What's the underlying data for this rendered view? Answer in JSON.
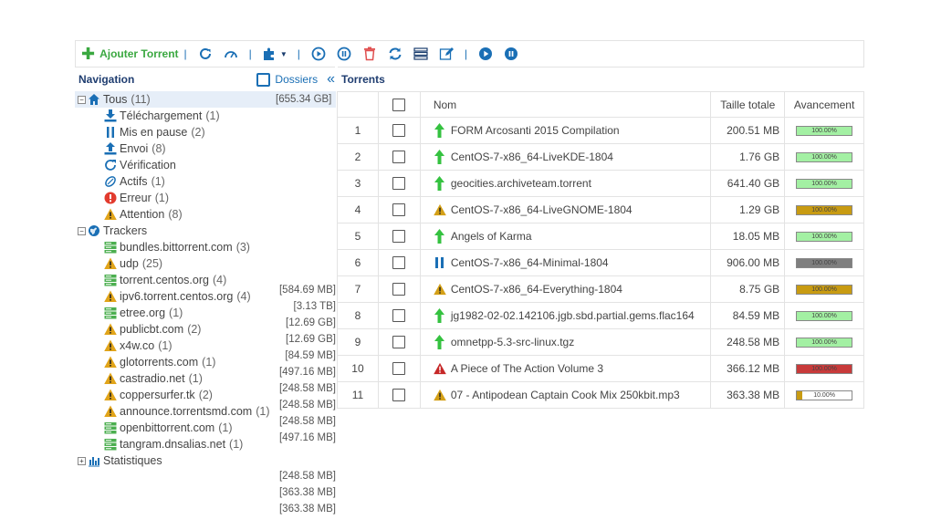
{
  "toolbar": {
    "add_label": "Ajouter Torrent",
    "sep": "|"
  },
  "nav": {
    "title": "Navigation",
    "folders_label": "Dossiers",
    "collapse_glyph": "«",
    "torrents_title": "Torrents"
  },
  "tree": {
    "all": {
      "label": "Tous",
      "count": "(11)",
      "size": "[655.34 GB]",
      "expander": "−"
    },
    "status": [
      {
        "label": "Téléchargement",
        "count": "(1)",
        "icon": "download-icon"
      },
      {
        "label": "Mis en pause",
        "count": "(2)",
        "icon": "pause-icon"
      },
      {
        "label": "Envoi",
        "count": "(8)",
        "icon": "upload-icon"
      },
      {
        "label": "Vérification",
        "count": "",
        "icon": "refresh-icon"
      },
      {
        "label": "Actifs",
        "count": "(1)",
        "icon": "active-icon"
      },
      {
        "label": "Erreur",
        "count": "(1)",
        "icon": "error-icon"
      },
      {
        "label": "Attention",
        "count": "(8)",
        "icon": "warning-icon"
      }
    ],
    "trackers": {
      "label": "Trackers",
      "expander": "−"
    },
    "tracker_items": [
      {
        "label": "bundles.bittorrent.com",
        "count": "(3)",
        "icon": "server-icon"
      },
      {
        "label": "udp",
        "count": "(25)",
        "icon": "warning-icon"
      },
      {
        "label": "torrent.centos.org",
        "count": "(4)",
        "icon": "server-icon"
      },
      {
        "label": "ipv6.torrent.centos.org",
        "count": "(4)",
        "icon": "warning-icon"
      },
      {
        "label": "etree.org",
        "count": "(1)",
        "icon": "server-icon"
      },
      {
        "label": "publicbt.com",
        "count": "(2)",
        "icon": "warning-icon"
      },
      {
        "label": "x4w.co",
        "count": "(1)",
        "icon": "warning-icon"
      },
      {
        "label": "glotorrents.com",
        "count": "(1)",
        "icon": "warning-icon"
      },
      {
        "label": "castradio.net",
        "count": "(1)",
        "icon": "warning-icon"
      },
      {
        "label": "coppersurfer.tk",
        "count": "(2)",
        "icon": "warning-icon"
      },
      {
        "label": "announce.torrentsmd.com",
        "count": "(1)",
        "icon": "warning-icon"
      },
      {
        "label": "openbittorrent.com",
        "count": "(1)",
        "icon": "server-icon"
      },
      {
        "label": "tangram.dnsalias.net",
        "count": "(1)",
        "icon": "server-icon"
      }
    ],
    "tracker_sizes": [
      "[584.69 MB]",
      "[3.13 TB]",
      "[12.69 GB]",
      "[12.69 GB]",
      "[84.59 MB]",
      "[497.16 MB]",
      "[248.58 MB]",
      "[248.58 MB]",
      "[248.58 MB]",
      "[497.16 MB]",
      "[248.58 MB]",
      "[363.38 MB]",
      "[363.38 MB]"
    ],
    "stats": {
      "label": "Statistiques",
      "expander": "+"
    }
  },
  "table": {
    "headers": {
      "name": "Nom",
      "size": "Taille totale",
      "progress": "Avancement"
    },
    "rows": [
      {
        "num": "1",
        "name": "FORM Arcosanti 2015 Compilation",
        "size": "200.51 MB",
        "progress": 100,
        "progress_label": "100.00%",
        "status": "seeding",
        "bar_color": "#a3f0a3"
      },
      {
        "num": "2",
        "name": "CentOS-7-x86_64-LiveKDE-1804",
        "size": "1.76 GB",
        "progress": 100,
        "progress_label": "100.00%",
        "status": "seeding",
        "bar_color": "#a3f0a3"
      },
      {
        "num": "3",
        "name": "geocities.archiveteam.torrent",
        "size": "641.40 GB",
        "progress": 100,
        "progress_label": "100.00%",
        "status": "seeding",
        "bar_color": "#a3f0a3"
      },
      {
        "num": "4",
        "name": "CentOS-7-x86_64-LiveGNOME-1804",
        "size": "1.29 GB",
        "progress": 100,
        "progress_label": "100.00%",
        "status": "warning",
        "bar_color": "#c89b12"
      },
      {
        "num": "5",
        "name": "Angels of Karma",
        "size": "18.05 MB",
        "progress": 100,
        "progress_label": "100.00%",
        "status": "seeding",
        "bar_color": "#a3f0a3"
      },
      {
        "num": "6",
        "name": "CentOS-7-x86_64-Minimal-1804",
        "size": "906.00 MB",
        "progress": 100,
        "progress_label": "100.00%",
        "status": "paused",
        "bar_color": "#7f7f7f"
      },
      {
        "num": "7",
        "name": "CentOS-7-x86_64-Everything-1804",
        "size": "8.75 GB",
        "progress": 100,
        "progress_label": "100.00%",
        "status": "warning",
        "bar_color": "#c89b12"
      },
      {
        "num": "8",
        "name": "jg1982-02-02.142106.jgb.sbd.partial.gems.flac164",
        "size": "84.59 MB",
        "progress": 100,
        "progress_label": "100.00%",
        "status": "seeding",
        "bar_color": "#a3f0a3"
      },
      {
        "num": "9",
        "name": "omnetpp-5.3-src-linux.tgz",
        "size": "248.58 MB",
        "progress": 100,
        "progress_label": "100.00%",
        "status": "seeding",
        "bar_color": "#a3f0a3"
      },
      {
        "num": "10",
        "name": "A Piece of The Action Volume 3",
        "size": "366.12 MB",
        "progress": 100,
        "progress_label": "100.00%",
        "status": "error",
        "bar_color": "#c83a3a"
      },
      {
        "num": "11",
        "name": "07 - Antipodean Captain Cook Mix 250kbit.mp3",
        "size": "363.38 MB",
        "progress": 10,
        "progress_label": "10.00%",
        "status": "warning",
        "bar_color": "#c89b12"
      }
    ]
  }
}
